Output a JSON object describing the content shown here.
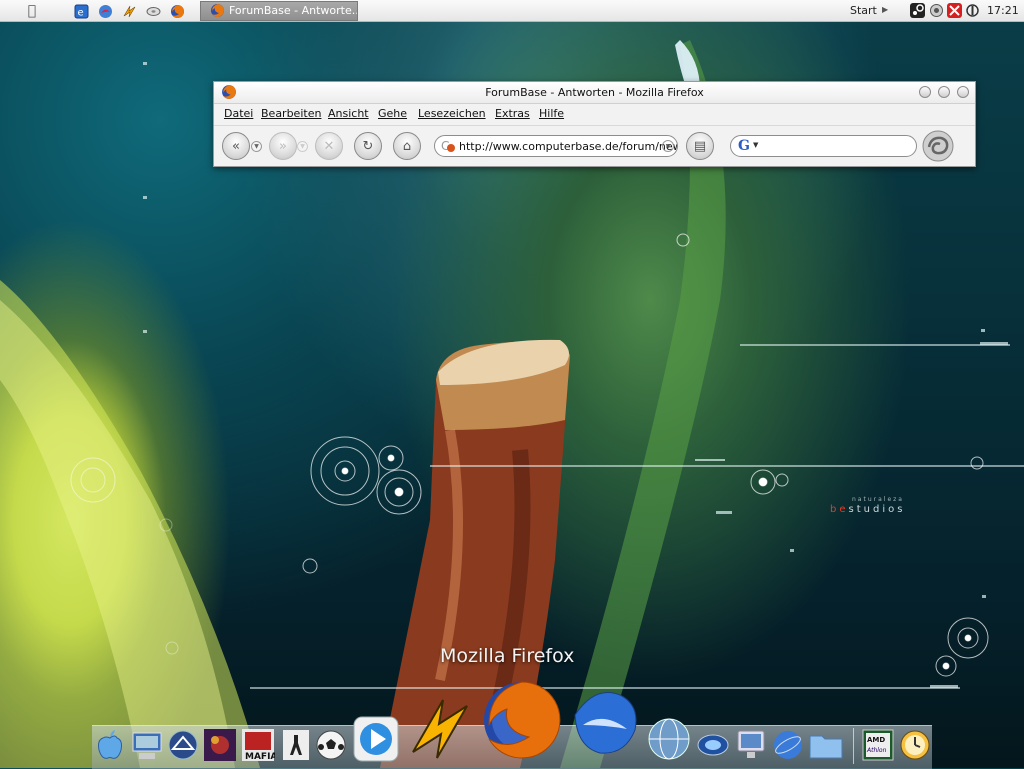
{
  "topbar": {
    "task_title": "ForumBase - Antworte...",
    "start_label": "Start",
    "clock": "17:21"
  },
  "window": {
    "title": "ForumBase - Antworten - Mozilla Firefox",
    "menu": [
      "Datei",
      "Bearbeiten",
      "Ansicht",
      "Gehe",
      "Lesezeichen",
      "Extras",
      "Hilfe"
    ],
    "url": "http://www.computerbase.de/forum/newr",
    "search_engine": "G"
  },
  "wallpaper": {
    "brand_be": "be",
    "brand_studios": "studios",
    "brand_sub": "naturaleza"
  },
  "dock": {
    "hover_label": "Mozilla Firefox",
    "items": [
      "finder-icon",
      "system-monitor-icon",
      "vmware-icon",
      "game-icon",
      "mafia-icon",
      "counter-strike-icon",
      "soccer-ball-icon",
      "media-player-icon",
      "winamp-icon",
      "firefox-icon",
      "thunderbird-icon",
      "network-globe-icon",
      "world-of-warcraft-icon",
      "computer-icon",
      "internet-explorer-icon",
      "folder-icon",
      "amd-athlon-icon",
      "clock-icon"
    ]
  }
}
